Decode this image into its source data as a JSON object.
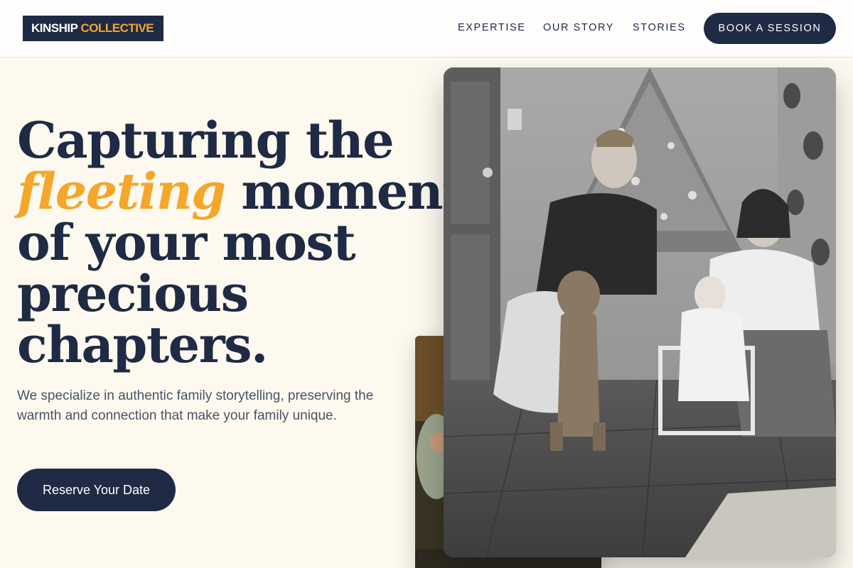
{
  "brand": {
    "name_part1": "KINSHIP",
    "name_part2": "COLLECTIVE"
  },
  "nav": {
    "items": [
      {
        "label": "EXPERTISE"
      },
      {
        "label": "OUR STORY"
      },
      {
        "label": "STORIES"
      }
    ],
    "cta_label": "BOOK A SESSION"
  },
  "hero": {
    "headline_line1": "Capturing the",
    "headline_accent": "fleeting",
    "headline_line2_rest": "moments",
    "headline_line3": "of your most",
    "headline_line4": "precious",
    "headline_line5": "chapters.",
    "subtext": "We specialize in authentic family storytelling, preserving the warmth and connection that make your family unique.",
    "cta_label": "Reserve Your Date"
  },
  "colors": {
    "navy": "#1f2a44",
    "accent": "#f4a72a",
    "background": "#fdf9ef"
  }
}
